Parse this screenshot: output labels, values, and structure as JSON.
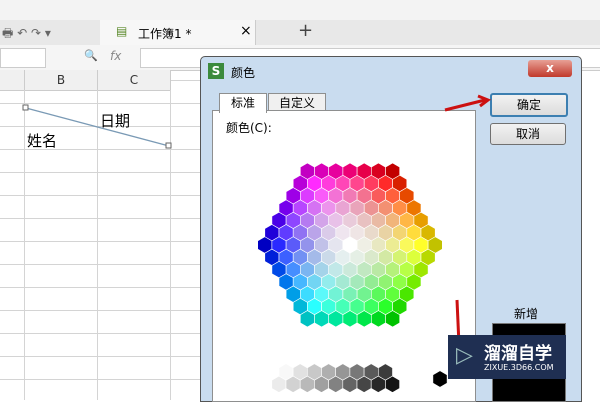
{
  "tabbar": {
    "doc_title": "工作簿1 *",
    "close": "×",
    "new_tab": "+"
  },
  "formula": {
    "zoom_icon": "🔍",
    "fx": "fx"
  },
  "sheet": {
    "columns": [
      "B",
      "C"
    ],
    "cell_header_top": "日期",
    "cell_header_bottom": "姓名"
  },
  "dialog": {
    "title": "颜色",
    "close": "x",
    "tabs": [
      "标准",
      "自定义"
    ],
    "color_label": "颜色(C):",
    "ok": "确定",
    "cancel": "取消",
    "new_label": "新增"
  },
  "watermark": {
    "name": "溜溜自学",
    "url": "ZIXUE.3D66.COM"
  },
  "colors": {
    "new_color": "#000000",
    "arrow": "#cc1111"
  }
}
